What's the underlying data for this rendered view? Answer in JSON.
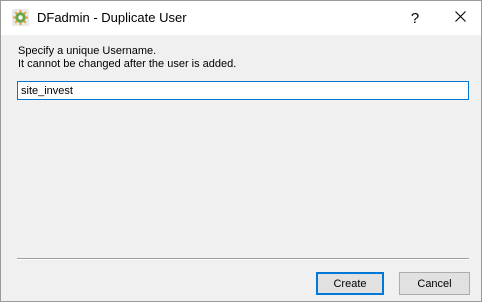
{
  "window": {
    "title": "DFadmin - Duplicate User",
    "help_label": "?",
    "close_icon": "close-icon",
    "app_icon": "dfadmin-gear-icon"
  },
  "dialog": {
    "instruction_line1": "Specify a unique Username.",
    "instruction_line2": "It cannot be changed after the user is added.",
    "username_value": "site_invest"
  },
  "buttons": {
    "create_label": "Create",
    "cancel_label": "Cancel"
  },
  "colors": {
    "accent": "#0078d7",
    "icon_green": "#6aa84f",
    "icon_orange": "#e8a33a"
  }
}
